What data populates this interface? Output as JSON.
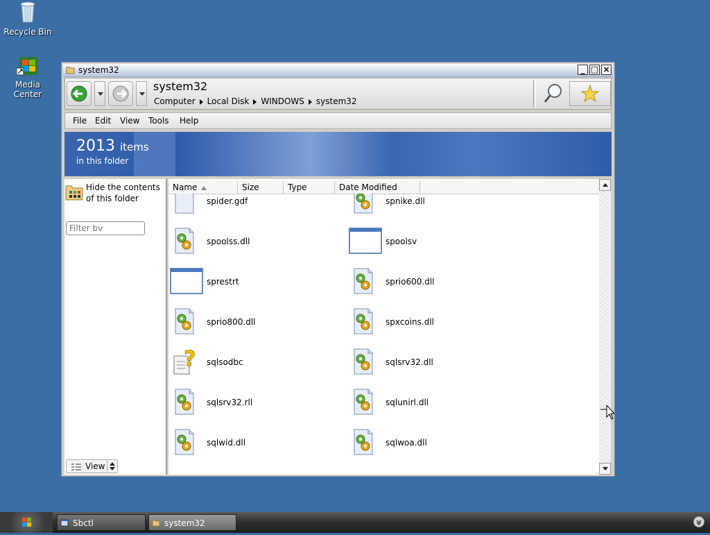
{
  "desktop": {
    "icons": [
      {
        "label": "Recycle Bin",
        "icon": "recycle-bin-icon"
      },
      {
        "label": "Media Center",
        "icon": "media-center-icon"
      }
    ]
  },
  "window": {
    "title": "system32",
    "controls": {
      "minimize": "_",
      "maximize": "□",
      "close": "×"
    },
    "address": {
      "current": "system32",
      "crumbs": [
        "Computer",
        "Local Disk",
        "WINDOWS",
        "system32"
      ]
    },
    "menu": [
      "File",
      "Edit",
      "View",
      "Tools",
      "Help"
    ],
    "banner": {
      "count": "2013",
      "items_word": "items",
      "subtitle": "in this folder"
    },
    "left_pane": {
      "hide_link": "Hide the contents of this folder",
      "filter_placeholder": "Filter bv",
      "view_label": "View"
    },
    "columns": [
      "Name",
      "Size",
      "Type",
      "Date Modified"
    ],
    "sort_column": "Name",
    "files": [
      {
        "name": "spider.gdf",
        "icon": "blank-file-icon"
      },
      {
        "name": "spnike.dll",
        "icon": "dll-gear-icon"
      },
      {
        "name": "spoolss.dll",
        "icon": "dll-gear-icon"
      },
      {
        "name": "spoolsv",
        "icon": "application-window-icon"
      },
      {
        "name": "sprestrt",
        "icon": "application-window-icon"
      },
      {
        "name": "sprio600.dll",
        "icon": "dll-gear-icon"
      },
      {
        "name": "sprio800.dll",
        "icon": "dll-gear-icon"
      },
      {
        "name": "spxcoins.dll",
        "icon": "dll-gear-icon"
      },
      {
        "name": "sqlsodbc",
        "icon": "unknown-file-question-icon"
      },
      {
        "name": "sqlsrv32.dll",
        "icon": "dll-gear-icon"
      },
      {
        "name": "sqlsrv32.rll",
        "icon": "dll-gear-icon"
      },
      {
        "name": "sqlunirl.dll",
        "icon": "dll-gear-icon"
      },
      {
        "name": "sqlwid.dll",
        "icon": "dll-gear-icon"
      },
      {
        "name": "sqlwoa.dll",
        "icon": "dll-gear-icon"
      }
    ]
  },
  "taskbar": {
    "buttons": [
      {
        "label": "Sbctl",
        "icon": "window-icon"
      },
      {
        "label": "system32",
        "icon": "folder-icon"
      }
    ]
  },
  "colors": {
    "desktop": "#3a6ea5",
    "banner": "#2d59a8",
    "taskbar": "#2e2e2e"
  }
}
